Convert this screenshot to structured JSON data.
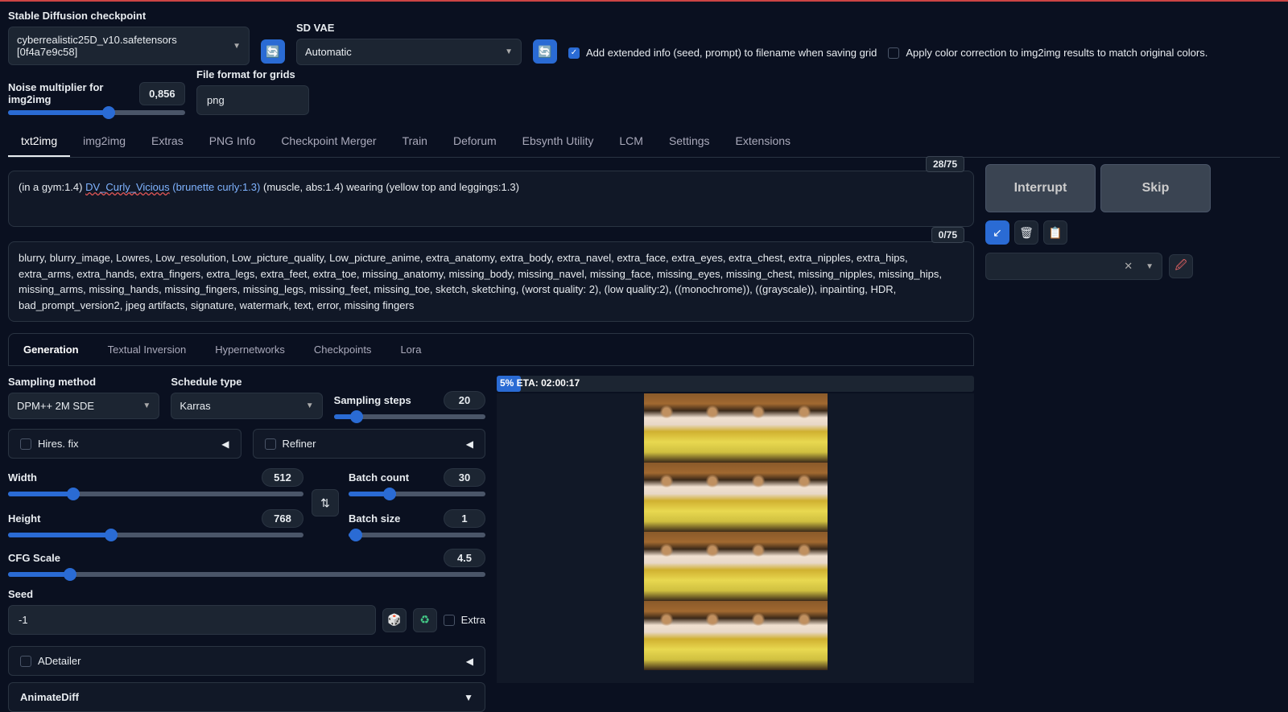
{
  "top": {
    "checkpoint_label": "Stable Diffusion checkpoint",
    "checkpoint_value": "cyberrealistic25D_v10.safetensors [0f4a7e9c58]",
    "vae_label": "SD VAE",
    "vae_value": "Automatic",
    "extended_info": "Add extended info (seed, prompt) to filename when saving grid",
    "color_correction": "Apply color correction to img2img results to match original colors.",
    "noise_label": "Noise multiplier for img2img",
    "noise_value": "0,856",
    "grid_format_label": "File format for grids",
    "grid_format_value": "png"
  },
  "tabs": [
    "txt2img",
    "img2img",
    "Extras",
    "PNG Info",
    "Checkpoint Merger",
    "Train",
    "Deforum",
    "Ebsynth Utility",
    "LCM",
    "Settings",
    "Extensions"
  ],
  "active_tab": 0,
  "prompt": {
    "tokens": "28/75",
    "seg1": "(in a gym:1.4)",
    "seg2_name": "DV_Curly_Vicious",
    "seg2_rest": " (brunette curly:1.3)",
    "seg3": "  (muscle, abs:1.4) wearing (yellow  top and leggings:1.3)"
  },
  "neg_prompt": {
    "tokens": "0/75",
    "text": "blurry, blurry_image, Lowres, Low_resolution, Low_picture_quality, Low_picture_anime, extra_anatomy, extra_body, extra_navel, extra_face, extra_eyes, extra_chest, extra_nipples, extra_hips, extra_arms, extra_hands, extra_fingers, extra_legs, extra_feet, extra_toe, missing_anatomy, missing_body, missing_navel, missing_face, missing_eyes, missing_chest, missing_nipples, missing_hips, missing_arms, missing_hands, missing_fingers, missing_legs, missing_feet, missing_toe, sketch, sketching, (worst quality: 2), (low quality:2), ((monochrome)), ((grayscale)), inpainting, HDR, bad_prompt_version2, jpeg artifacts, signature, watermark, text, error, missing fingers"
  },
  "actions": {
    "interrupt": "Interrupt",
    "skip": "Skip"
  },
  "subtabs": [
    "Generation",
    "Textual Inversion",
    "Hypernetworks",
    "Checkpoints",
    "Lora"
  ],
  "active_subtab": 0,
  "gen": {
    "sampling_method_label": "Sampling method",
    "sampling_method_value": "DPM++ 2M SDE",
    "schedule_label": "Schedule type",
    "schedule_value": "Karras",
    "sampling_steps_label": "Sampling steps",
    "sampling_steps_value": "20",
    "hires_label": "Hires. fix",
    "refiner_label": "Refiner",
    "width_label": "Width",
    "width_value": "512",
    "height_label": "Height",
    "height_value": "768",
    "batch_count_label": "Batch count",
    "batch_count_value": "30",
    "batch_size_label": "Batch size",
    "batch_size_value": "1",
    "cfg_label": "CFG Scale",
    "cfg_value": "4.5",
    "seed_label": "Seed",
    "seed_value": "-1",
    "extra_label": "Extra",
    "adetailer_label": "ADetailer",
    "animatediff_label": "AnimateDiff"
  },
  "progress": {
    "text": "5% ETA: 02:00:17",
    "pct": 5
  }
}
